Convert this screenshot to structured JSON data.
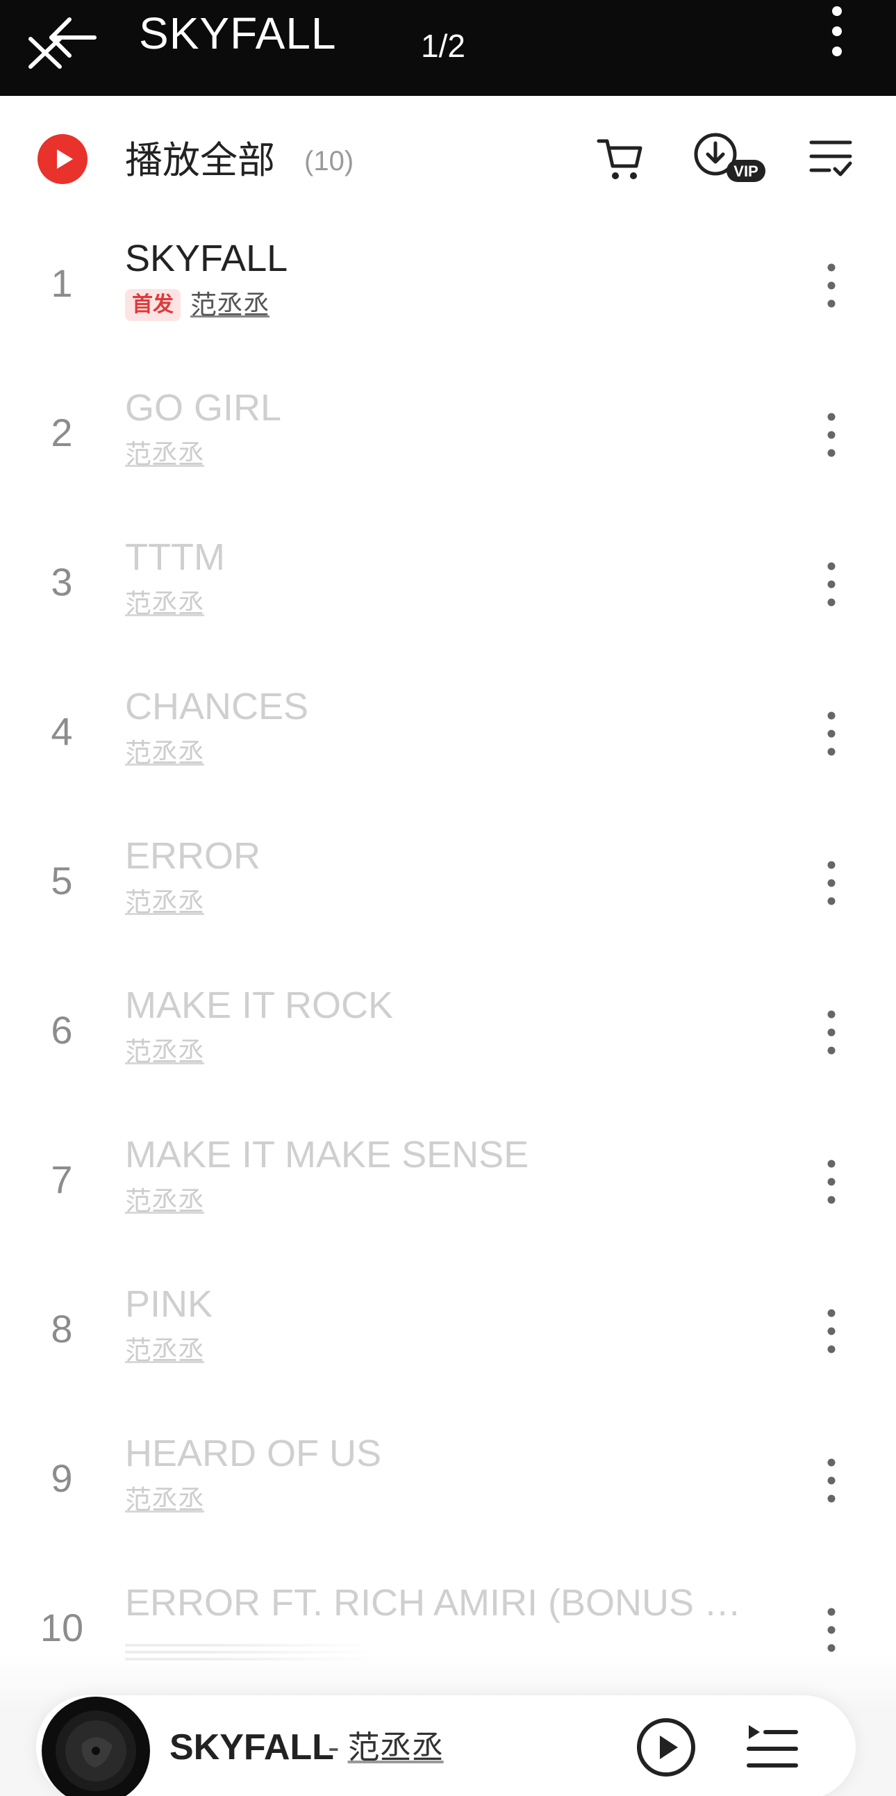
{
  "topbar": {
    "title": "SKYFALL",
    "page_indicator": "1/2",
    "back_icon": "back-close-icon",
    "more_icon": "vertical-dots-icon"
  },
  "header": {
    "play_all_label": "播放全部",
    "count": "(10)",
    "play_icon": "play-circle-icon",
    "cart_icon": "cart-icon",
    "download_icon": "download-vip-icon",
    "download_badge": "VIP",
    "multiselect_icon": "multi-select-icon"
  },
  "songs": [
    {
      "num": "1",
      "title": "SKYFALL",
      "artist": "范丞丞",
      "badge": "首发"
    },
    {
      "num": "2",
      "title": "GO GIRL",
      "artist": "范丞丞"
    },
    {
      "num": "3",
      "title": "TTTM",
      "artist": "范丞丞"
    },
    {
      "num": "4",
      "title": "CHANCES",
      "artist": "范丞丞"
    },
    {
      "num": "5",
      "title": "ERROR",
      "artist": "范丞丞"
    },
    {
      "num": "6",
      "title": "MAKE IT ROCK",
      "artist": "范丞丞"
    },
    {
      "num": "7",
      "title": "MAKE IT MAKE SENSE",
      "artist": "范丞丞"
    },
    {
      "num": "8",
      "title": "PINK",
      "artist": "范丞丞"
    },
    {
      "num": "9",
      "title": "HEARD OF US",
      "artist": "范丞丞"
    },
    {
      "num": "10",
      "title": "ERROR FT. RICH AMIRI (BONUS TR…"
    }
  ],
  "player": {
    "song": "SKYFALL",
    "separator": "-",
    "artist": "范丞丞",
    "play_icon": "play-circle-outline-icon",
    "queue_icon": "playlist-queue-icon"
  },
  "colors": {
    "topbar_bg": "#0b0b0b",
    "accent_red": "#e8322b",
    "badge_bg": "#fde4e4",
    "badge_text": "#e03a3a",
    "active_text": "#222222",
    "inactive_text": "#cfcfcf"
  }
}
